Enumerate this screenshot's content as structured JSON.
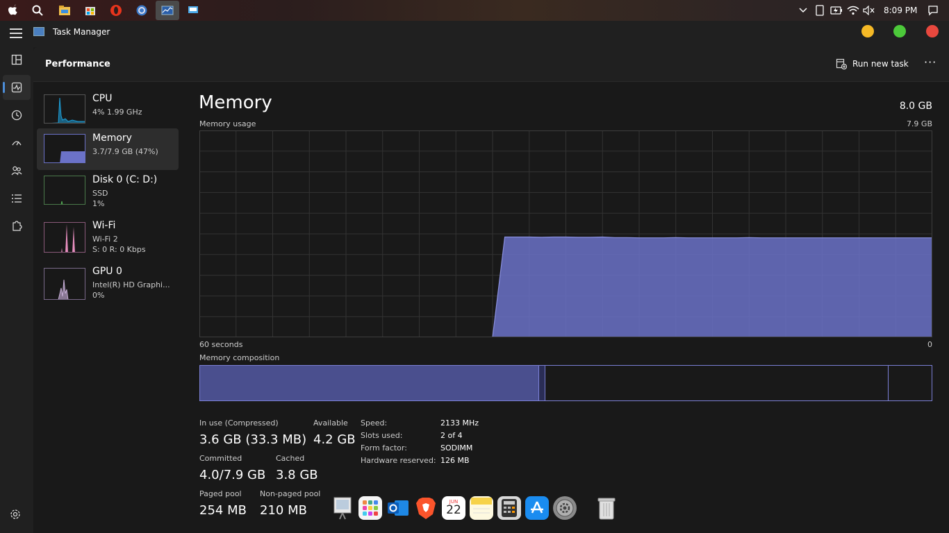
{
  "menubar": {
    "clock": "8:09 PM"
  },
  "titlebar": {
    "app_title": "Task Manager"
  },
  "header": {
    "title": "Performance",
    "run_new_task": "Run new task",
    "more": "···"
  },
  "sidebar": {
    "items": [
      {
        "name": "CPU",
        "line1": "4% 1.99 GHz",
        "line2": ""
      },
      {
        "name": "Memory",
        "line1": "3.7/7.9 GB (47%)",
        "line2": ""
      },
      {
        "name": "Disk 0 (C: D:)",
        "line1": "SSD",
        "line2": "1%"
      },
      {
        "name": "Wi-Fi",
        "line1": "Wi-Fi 2",
        "line2": "S: 0 R: 0 Kbps"
      },
      {
        "name": "GPU 0",
        "line1": "Intel(R) HD Graphi...",
        "line2": "0%"
      }
    ]
  },
  "main": {
    "title": "Memory",
    "total": "8.0 GB",
    "usage_label": "Memory usage",
    "usage_max": "7.9 GB",
    "time_left": "60 seconds",
    "time_right": "0",
    "composition_label": "Memory composition",
    "stats": {
      "in_use_label": "In use (Compressed)",
      "in_use_value": "3.6 GB (33.3 MB)",
      "available_label": "Available",
      "available_value": "4.2 GB",
      "committed_label": "Committed",
      "committed_value": "4.0/7.9 GB",
      "cached_label": "Cached",
      "cached_value": "3.8 GB",
      "paged_label": "Paged pool",
      "paged_value": "254 MB",
      "nonpaged_label": "Non-paged pool",
      "nonpaged_value": "210 MB"
    },
    "details": [
      {
        "key": "Speed:",
        "value": "2133 MHz"
      },
      {
        "key": "Slots used:",
        "value": "2 of 4"
      },
      {
        "key": "Form factor:",
        "value": "SODIMM"
      },
      {
        "key": "Hardware reserved:",
        "value": "126 MB"
      }
    ],
    "usage_series": [
      0,
      0,
      0,
      0,
      0,
      0,
      0,
      0,
      0,
      0,
      0,
      0,
      0,
      0,
      0,
      0,
      0,
      0,
      0,
      0,
      0,
      0,
      0,
      0,
      0,
      3.83,
      3.83,
      3.83,
      3.82,
      3.83,
      3.83,
      3.82,
      3.82,
      3.83,
      3.81,
      3.81,
      3.8,
      3.8,
      3.8,
      3.81,
      3.8,
      3.8,
      3.8,
      3.8,
      3.8,
      3.81,
      3.8,
      3.8,
      3.8,
      3.8,
      3.8,
      3.8,
      3.8,
      3.8,
      3.8,
      3.8,
      3.8,
      3.8,
      3.8,
      3.8,
      3.8
    ],
    "usage_ymax": 7.9
  },
  "colors": {
    "memory": "#6b72c8",
    "memory_line": "#8a90e0",
    "grid": "#333333",
    "cpu": "#1e9fd8",
    "wifi": "#e88fc0",
    "gpu": "#b89fc8"
  },
  "dock": {
    "calendar_month": "JUN",
    "calendar_day": "22"
  }
}
